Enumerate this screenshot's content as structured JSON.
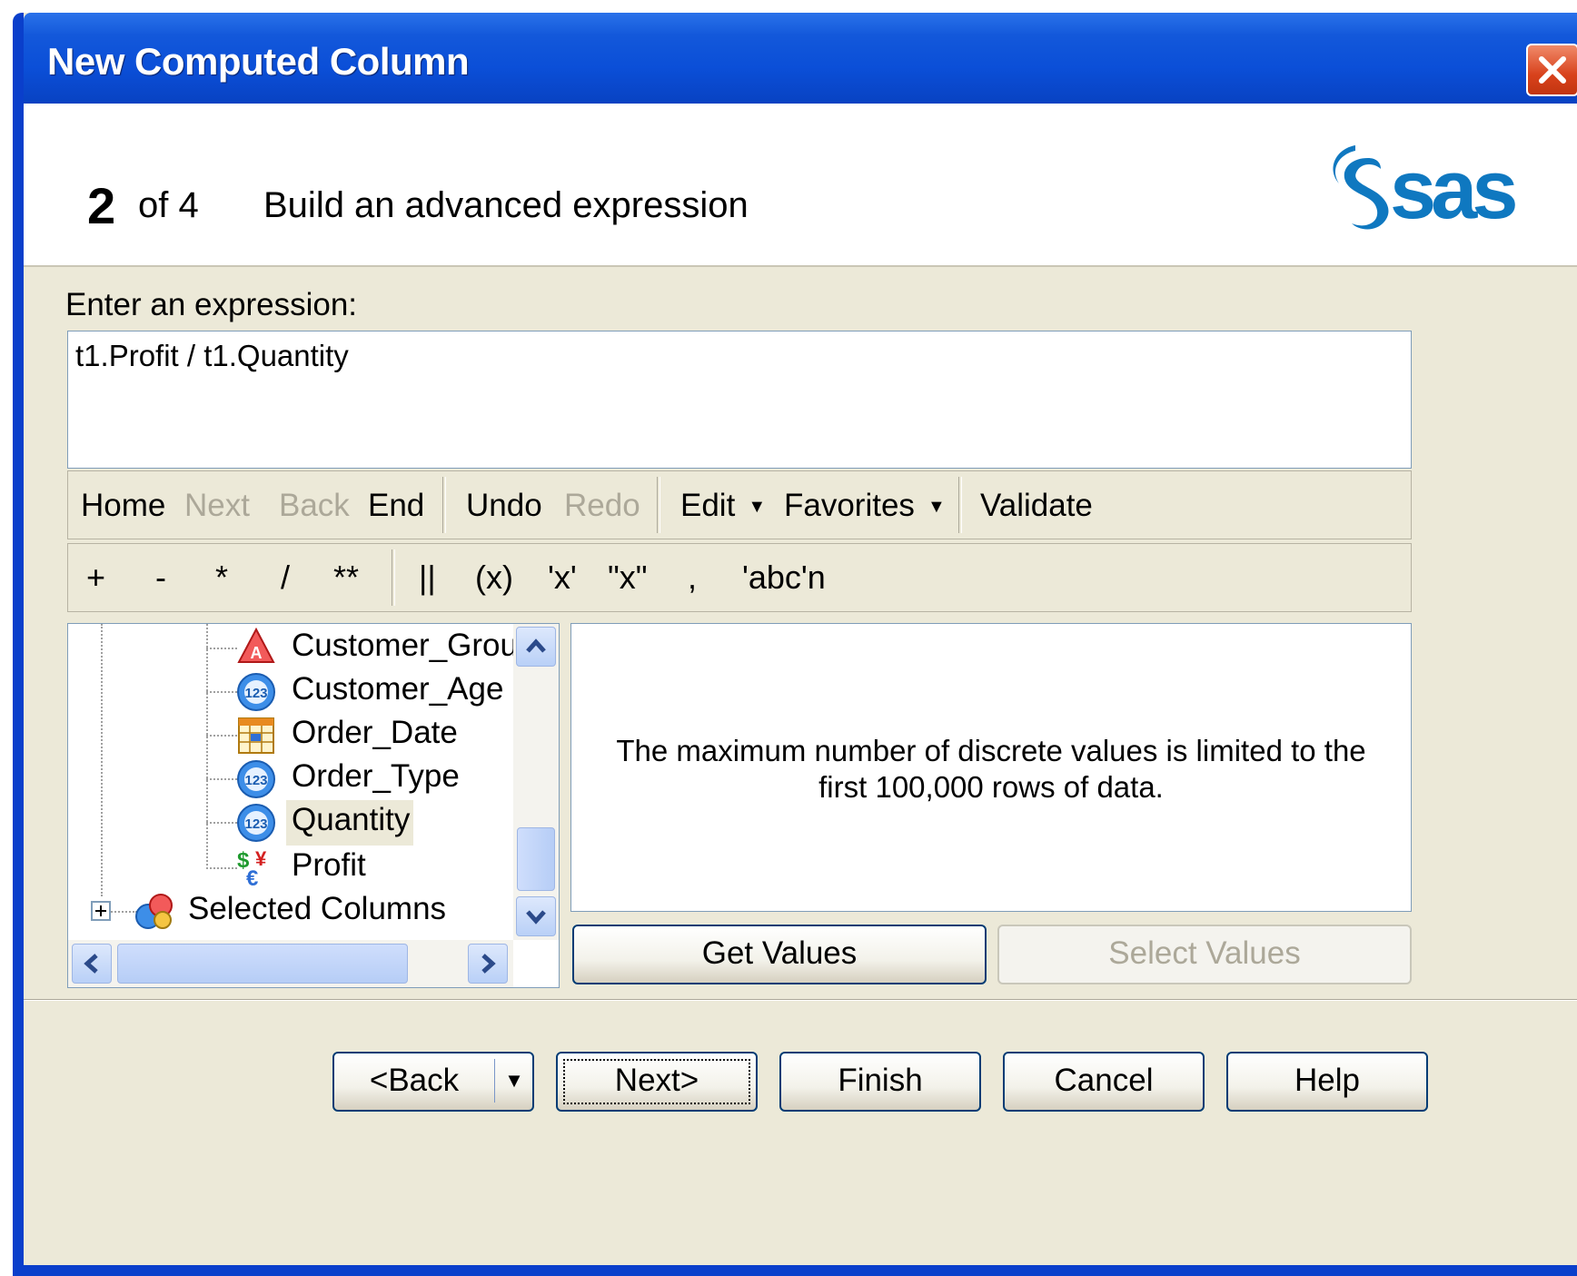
{
  "window": {
    "title": "New Computed Column"
  },
  "header": {
    "step_number": "2",
    "step_of": "of 4",
    "step_title": "Build an advanced expression",
    "logo_text": "sas"
  },
  "expression": {
    "label": "Enter an expression:",
    "value": "t1.Profit / t1.Quantity"
  },
  "toolbar": {
    "home": "Home",
    "next": "Next",
    "back": "Back",
    "end": "End",
    "undo": "Undo",
    "redo": "Redo",
    "edit": "Edit",
    "favorites": "Favorites",
    "validate": "Validate"
  },
  "operators": {
    "plus": "+",
    "minus": "-",
    "multiply": "*",
    "divide": "/",
    "power": "**",
    "concat": "||",
    "paren": "(x)",
    "single_quote": "'x'",
    "double_quote": "\"x\"",
    "comma": ",",
    "newline_string": "'abc'n"
  },
  "tree": {
    "items": [
      {
        "label": "Customer_Group",
        "icon": "character-column-icon"
      },
      {
        "label": "Customer_Age",
        "icon": "numeric-column-icon"
      },
      {
        "label": "Order_Date",
        "icon": "date-column-icon"
      },
      {
        "label": "Order_Type",
        "icon": "numeric-column-icon"
      },
      {
        "label": "Quantity",
        "icon": "numeric-column-icon",
        "selected": true
      },
      {
        "label": "Profit",
        "icon": "currency-column-icon"
      }
    ],
    "group": {
      "label": "Selected Columns",
      "icon": "selected-columns-icon"
    }
  },
  "values_panel": {
    "message": "The maximum number of discrete values is limited to the first 100,000 rows of data."
  },
  "buttons": {
    "get_values": "Get Values",
    "select_values": "Select Values",
    "back": "<Back",
    "next": "Next>",
    "finish": "Finish",
    "cancel": "Cancel",
    "help": "Help"
  },
  "colors": {
    "titlebar": "#0b4fd8",
    "sas_blue": "#0f78c0",
    "dialog_bg": "#ece9d8"
  }
}
